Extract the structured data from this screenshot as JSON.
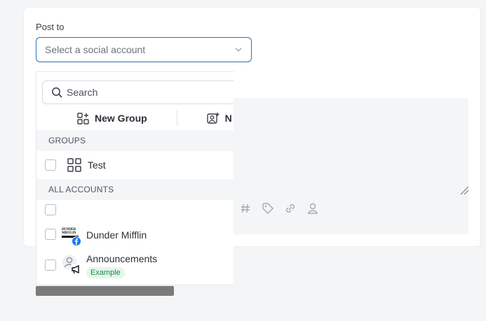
{
  "form": {
    "post_to_label": "Post to",
    "select_placeholder": "Select a social account"
  },
  "dropdown": {
    "search_placeholder": "Search",
    "actions": [
      {
        "label": "New Group",
        "icon": "grid-plus-icon"
      },
      {
        "label": "N",
        "icon": "user-plus-icon"
      }
    ],
    "groups_header": "GROUPS",
    "groups": [
      {
        "label": "Test",
        "icon": "grid-icon"
      }
    ],
    "accounts_header": "ALL ACCOUNTS",
    "accounts": [
      {
        "label": "",
        "icon": ""
      },
      {
        "label": "Dunder Mifflin",
        "icon": "facebook-icon",
        "logo_text": "DUNDER MIFFLIN"
      },
      {
        "label": "Announcements",
        "icon": "megaphone-icon",
        "badge": "Example"
      }
    ]
  },
  "editor": {
    "tools": [
      "hashtag-icon",
      "tag-icon",
      "link-icon",
      "user-tag-icon"
    ]
  },
  "colors": {
    "accent": "#2f6fb3",
    "badge_green": "#1f8a4c",
    "facebook_blue": "#1877f2"
  }
}
